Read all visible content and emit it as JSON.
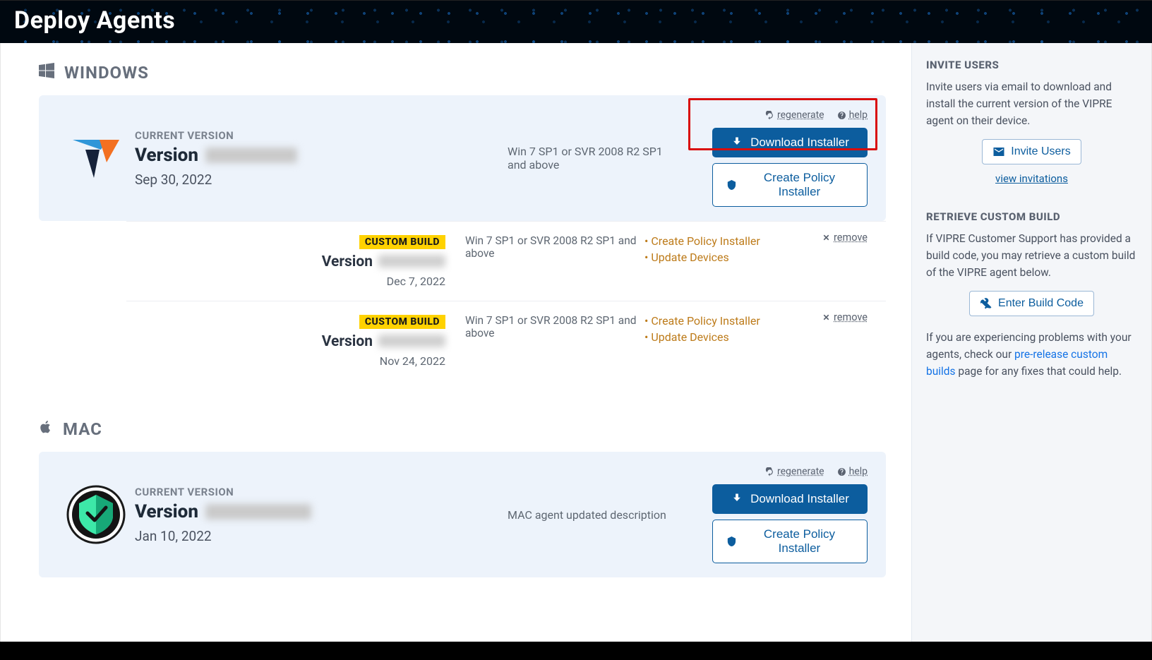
{
  "header": {
    "title": "Deploy Agents"
  },
  "windows": {
    "heading": "WINDOWS",
    "current": {
      "label": "CURRENT VERSION",
      "version_word": "Version",
      "date": "Sep 30, 2022",
      "description": "Win 7 SP1 or SVR 2008 R2 SP1 and above",
      "regenerate": "regenerate",
      "help": "help",
      "download": "Download Installer",
      "policy": "Create Policy Installer"
    },
    "custom": [
      {
        "badge": "CUSTOM BUILD",
        "version_word": "Version",
        "date": "Dec 7, 2022",
        "description": "Win 7 SP1 or SVR 2008 R2 SP1 and above",
        "link_policy": "Create Policy Installer",
        "link_update": "Update Devices",
        "remove": "remove"
      },
      {
        "badge": "CUSTOM BUILD",
        "version_word": "Version",
        "date": "Nov 24, 2022",
        "description": "Win 7 SP1 or SVR 2008 R2 SP1 and above",
        "link_policy": "Create Policy Installer",
        "link_update": "Update Devices",
        "remove": "remove"
      }
    ]
  },
  "mac": {
    "heading": "MAC",
    "current": {
      "label": "CURRENT VERSION",
      "version_word": "Version",
      "date": "Jan 10, 2022",
      "description": "MAC agent updated description",
      "regenerate": "regenerate",
      "help": "help",
      "download": "Download Installer",
      "policy": "Create Policy Installer"
    }
  },
  "sidebar": {
    "invite": {
      "title": "INVITE USERS",
      "text": "Invite users via email to download and install the current version of the VIPRE agent on their device.",
      "button": "Invite Users",
      "link": "view invitations"
    },
    "retrieve": {
      "title": "RETRIEVE CUSTOM BUILD",
      "text": "If VIPRE Customer Support has provided a build code, you may retrieve a custom build of the VIPRE agent below.",
      "button": "Enter Build Code",
      "text2_a": "If you are experiencing problems with your agents, check our ",
      "text2_link": "pre-release custom builds",
      "text2_b": " page for any fixes that could help."
    }
  }
}
